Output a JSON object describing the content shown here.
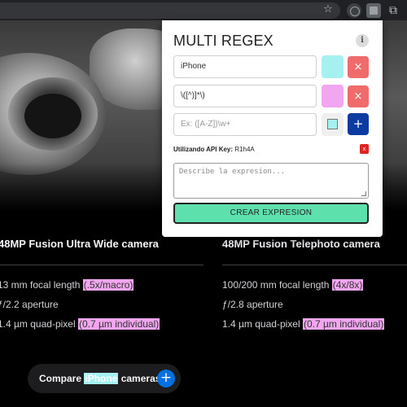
{
  "browser": {
    "icons": [
      "star-icon",
      "block-icon",
      "regex-extension-icon",
      "puzzle-icon"
    ]
  },
  "page": {
    "cameras": [
      {
        "title": "48MP Fusion Ultra Wide camera",
        "specs": [
          {
            "text": "13 mm focal length ",
            "highlight": "(.5x/macro)"
          },
          {
            "text": "ƒ/2.2 aperture",
            "highlight": ""
          },
          {
            "text": "1.4 µm quad-pixel ",
            "highlight": "(0.7 µm individual)"
          }
        ]
      },
      {
        "title": "48MP Fusion Telephoto camera",
        "specs": [
          {
            "text": "100/200 mm focal length ",
            "highlight": "(4x/8x)"
          },
          {
            "text": "ƒ/2.8 aperture",
            "highlight": ""
          },
          {
            "text": "1.4 µm quad-pixel ",
            "highlight": "(0.7 µm individual)"
          }
        ]
      }
    ],
    "compare": {
      "before": "Compare ",
      "highlight": "iPhone",
      "after": " cameras",
      "button": "+"
    }
  },
  "popup": {
    "title": "MULTI REGEX",
    "info_label": "i",
    "rules": [
      {
        "pattern": "iPhone",
        "color": "#a6f0f2",
        "delete_label": "×"
      },
      {
        "pattern": "\\([^)]*\\)",
        "color": "#f2a6f0",
        "delete_label": "×"
      }
    ],
    "new_rule": {
      "placeholder": "Ex: ([A-Z])\\w+",
      "color": "#a6f0f2",
      "add_label": "+"
    },
    "api": {
      "label": "Utilizando API Key:",
      "value": "R1h4A",
      "delete_label": "x"
    },
    "describe_placeholder": "Describe la expresion...",
    "create_button": "CREAR EXPRESION"
  },
  "colors": {
    "accent_blue": "#0071e3",
    "create_green": "#5ee0ad",
    "delete_red": "#f06b6b",
    "highlight_pink": "#f2a6f0",
    "highlight_cyan": "#a6f0f2"
  }
}
